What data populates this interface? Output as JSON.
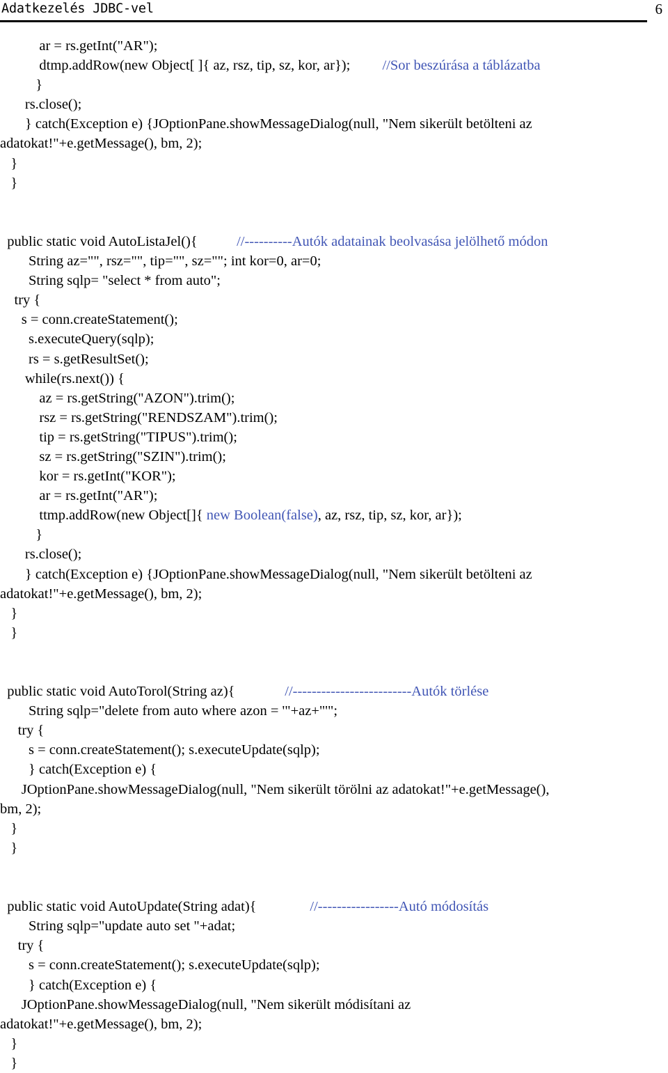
{
  "header": {
    "title": "Adatkezelés JDBC-vel",
    "page_number": "6"
  },
  "colors": {
    "text": "#000000",
    "comment_blue": "#4156b5",
    "rule": "#000000",
    "background": "#ffffff"
  },
  "code": {
    "lines": [
      {
        "indent": "           ",
        "text": "ar = rs.getInt(\"AR\");"
      },
      {
        "indent": "           ",
        "text": "dtmp.addRow(new Object[ ]{ az, rsz, tip, sz, kor, ar});",
        "gap": "         ",
        "comment": "//Sor beszúrása a táblázatba"
      },
      {
        "indent": "          ",
        "text": "}"
      },
      {
        "indent": "       ",
        "text": "rs.close();"
      },
      {
        "indent": "       ",
        "text": "} catch(Exception e) {JOptionPane.showMessageDialog(null, \"Nem sikerült betölteni az"
      },
      {
        "indent": "",
        "text": "adatokat!\"+e.getMessage(), bm, 2);"
      },
      {
        "indent": "   ",
        "text": "}"
      },
      {
        "indent": "   ",
        "text": "}"
      },
      {
        "blank": true
      },
      {
        "blank": true
      },
      {
        "indent": "  ",
        "text": "public static void AutoListaJel(){",
        "gap": "           ",
        "comment": "//----------Autók adatainak beolvasása jelölhető módon"
      },
      {
        "indent": "        ",
        "text": "String az=\"\", rsz=\"\", tip=\"\", sz=\"\"; int kor=0, ar=0;"
      },
      {
        "indent": "        ",
        "text": "String sqlp= \"select * from auto\";"
      },
      {
        "indent": "    ",
        "text": "try {"
      },
      {
        "indent": "      ",
        "text": "s = conn.createStatement();"
      },
      {
        "indent": "        ",
        "text": "s.executeQuery(sqlp);"
      },
      {
        "indent": "        ",
        "text": "rs = s.getResultSet();"
      },
      {
        "indent": "       ",
        "text": "while(rs.next()) {"
      },
      {
        "indent": "           ",
        "text": "az = rs.getString(\"AZON\").trim();"
      },
      {
        "indent": "           ",
        "text": "rsz = rs.getString(\"RENDSZAM\").trim();"
      },
      {
        "indent": "           ",
        "text": "tip = rs.getString(\"TIPUS\").trim();"
      },
      {
        "indent": "           ",
        "text": "sz = rs.getString(\"SZIN\").trim();"
      },
      {
        "indent": "           ",
        "text": "kor = rs.getInt(\"KOR\");"
      },
      {
        "indent": "           ",
        "text": "ar = rs.getInt(\"AR\");"
      },
      {
        "indent": "           ",
        "text": "ttmp.addRow(new Object[]{ ",
        "blue_mid": "new Boolean(false)",
        "text_after": ", az, rsz, tip, sz, kor, ar});"
      },
      {
        "indent": "          ",
        "text": "}"
      },
      {
        "indent": "       ",
        "text": "rs.close();"
      },
      {
        "indent": "       ",
        "text": "} catch(Exception e) {JOptionPane.showMessageDialog(null, \"Nem sikerült betölteni az"
      },
      {
        "indent": "",
        "text": "adatokat!\"+e.getMessage(), bm, 2);"
      },
      {
        "indent": "   ",
        "text": "}"
      },
      {
        "indent": "   ",
        "text": "}"
      },
      {
        "blank": true
      },
      {
        "blank": true
      },
      {
        "indent": "  ",
        "text": "public static void AutoTorol(String az){",
        "gap": "              ",
        "comment": "//-------------------------Autók törlése"
      },
      {
        "indent": "        ",
        "text": "String sqlp=\"delete from auto where azon = '\"+az+\"'\";"
      },
      {
        "indent": "     ",
        "text": "try {"
      },
      {
        "indent": "        ",
        "text": "s = conn.createStatement(); s.executeUpdate(sqlp);"
      },
      {
        "indent": "        ",
        "text": "} catch(Exception e) {"
      },
      {
        "indent": "      ",
        "text": "JOptionPane.showMessageDialog(null, \"Nem sikerült törölni az adatokat!\"+e.getMessage(),"
      },
      {
        "indent": "",
        "text": "bm, 2);"
      },
      {
        "indent": "   ",
        "text": "}"
      },
      {
        "indent": "   ",
        "text": "}"
      },
      {
        "blank": true
      },
      {
        "blank": true
      },
      {
        "indent": "  ",
        "text": "public static void AutoUpdate(String adat){",
        "gap": "               ",
        "comment": "//-----------------Autó módosítás"
      },
      {
        "indent": "        ",
        "text": "String sqlp=\"update auto set \"+adat;"
      },
      {
        "indent": "     ",
        "text": "try {"
      },
      {
        "indent": "        ",
        "text": "s = conn.createStatement(); s.executeUpdate(sqlp);"
      },
      {
        "indent": "        ",
        "text": "} catch(Exception e) {"
      },
      {
        "indent": "      ",
        "text": "JOptionPane.showMessageDialog(null, \"Nem sikerült módisítani az"
      },
      {
        "indent": "",
        "text": "adatokat!\"+e.getMessage(), bm, 2);"
      },
      {
        "indent": "   ",
        "text": "}"
      },
      {
        "indent": "   ",
        "text": "}"
      }
    ]
  }
}
